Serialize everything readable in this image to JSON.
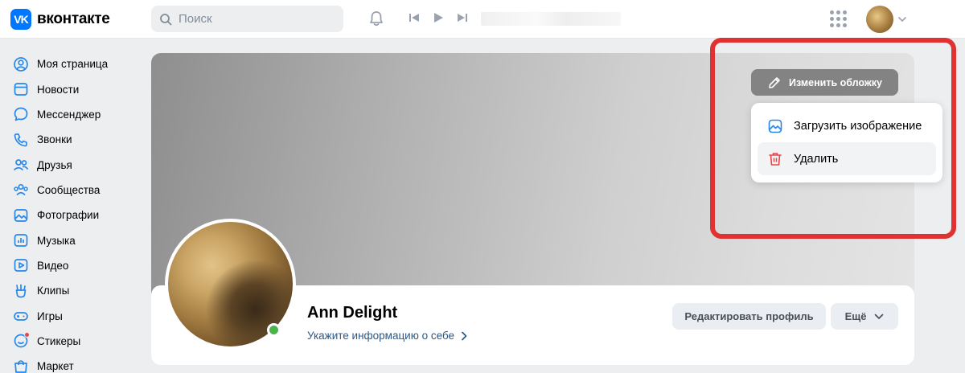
{
  "header": {
    "logo_mark": "VK",
    "logo_text": "вконтакте",
    "search_placeholder": "Поиск"
  },
  "sidebar": {
    "items": [
      {
        "label": "Моя страница",
        "icon": "user-circle-icon"
      },
      {
        "label": "Новости",
        "icon": "news-icon"
      },
      {
        "label": "Мессенджер",
        "icon": "message-icon"
      },
      {
        "label": "Звонки",
        "icon": "phone-icon"
      },
      {
        "label": "Друзья",
        "icon": "friends-icon"
      },
      {
        "label": "Сообщества",
        "icon": "communities-icon"
      },
      {
        "label": "Фотографии",
        "icon": "photo-icon"
      },
      {
        "label": "Музыка",
        "icon": "music-icon"
      },
      {
        "label": "Видео",
        "icon": "video-icon"
      },
      {
        "label": "Клипы",
        "icon": "clips-icon"
      },
      {
        "label": "Игры",
        "icon": "games-icon"
      },
      {
        "label": "Стикеры",
        "icon": "stickers-icon"
      },
      {
        "label": "Маркет",
        "icon": "market-icon"
      }
    ]
  },
  "profile": {
    "change_cover_label": "Изменить обложку",
    "menu": {
      "upload_label": "Загрузить изображение",
      "delete_label": "Удалить"
    },
    "name": "Ann Delight",
    "about_link": "Укажите информацию о себе",
    "edit_button": "Редактировать профиль",
    "more_button": "Ещё"
  },
  "colors": {
    "accent": "#0077ff",
    "link": "#2a5885",
    "highlight": "#e03232",
    "online": "#4bb34b",
    "danger": "#e64646"
  }
}
